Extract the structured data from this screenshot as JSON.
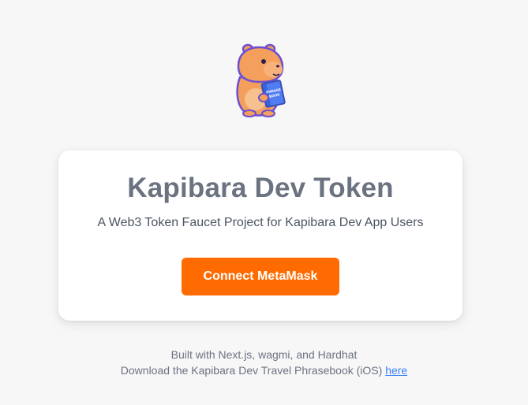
{
  "mascot": {
    "icon": "capybara-mascot-icon",
    "book_text_line1": "PHRASE",
    "book_text_line2": "BOOK"
  },
  "card": {
    "title": "Kapibara Dev Token",
    "subtitle": "A Web3 Token Faucet Project for Kapibara Dev App Users",
    "connect_button_label": "Connect MetaMask"
  },
  "footer": {
    "built_with": "Built with Next.js, wagmi, and Hardhat",
    "download_text": "Download the Kapibara Dev Travel Phrasebook (iOS)",
    "link_label": "here"
  },
  "colors": {
    "background": "#f7f7f8",
    "accent": "#ff6b00",
    "title": "#6b7280",
    "link": "#3b82f6",
    "mascot_body": "#f4a05c",
    "mascot_outline": "#6d4fd1"
  }
}
